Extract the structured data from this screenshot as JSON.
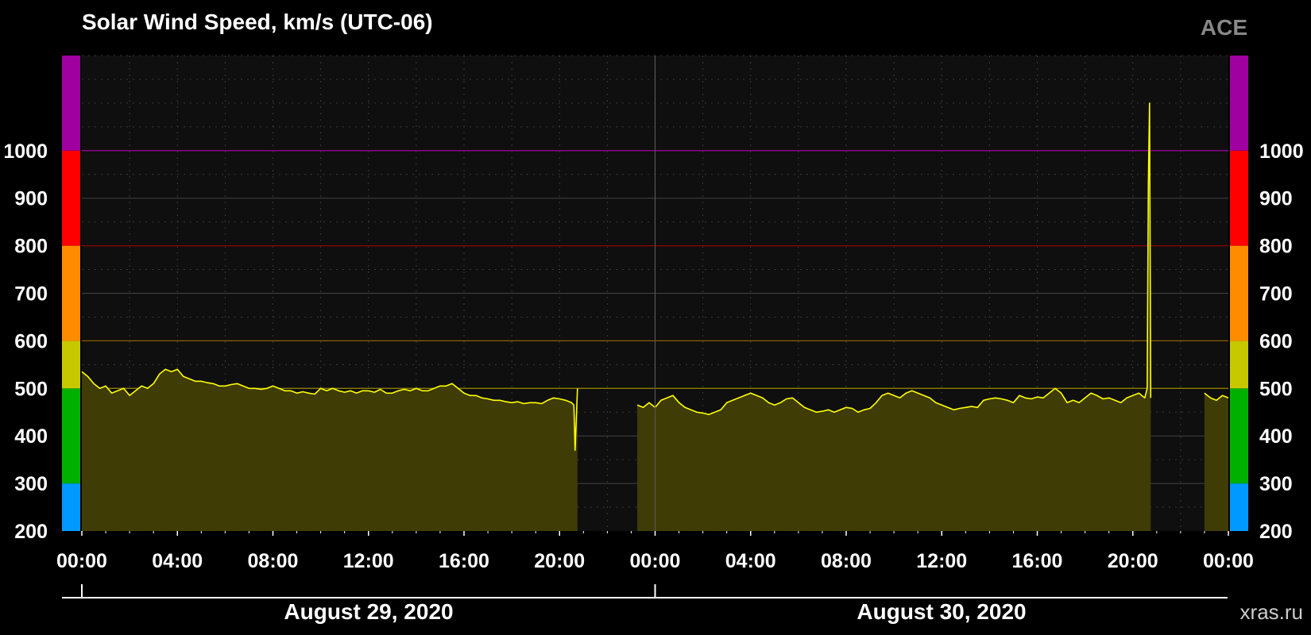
{
  "chart_data": {
    "type": "area",
    "title": "Solar Wind Speed, km/s (UTC-06)",
    "instrument": "ACE",
    "credit": "xras.ru",
    "ylim": [
      200,
      1200
    ],
    "yticks": [
      200,
      300,
      400,
      500,
      600,
      700,
      800,
      900,
      1000
    ],
    "ytick_labels": [
      "200",
      "300",
      "400",
      "500",
      "600",
      "700",
      "800",
      "900",
      "1000"
    ],
    "xlim": [
      0,
      48
    ],
    "xticks": [
      0,
      4,
      8,
      12,
      16,
      20,
      24,
      28,
      32,
      36,
      40,
      44,
      48
    ],
    "xtick_labels": [
      "00:00",
      "04:00",
      "08:00",
      "12:00",
      "16:00",
      "20:00",
      "00:00",
      "04:00",
      "08:00",
      "12:00",
      "16:00",
      "20:00",
      "00:00"
    ],
    "day_labels": [
      "August 29, 2020",
      "August 30, 2020"
    ],
    "grid": true,
    "threshold_bands": [
      {
        "from": 200,
        "to": 300,
        "color": "#0099ff"
      },
      {
        "from": 300,
        "to": 500,
        "color": "#00b000"
      },
      {
        "from": 500,
        "to": 600,
        "color": "#c8c800"
      },
      {
        "from": 600,
        "to": 800,
        "color": "#ff8c00"
      },
      {
        "from": 800,
        "to": 1000,
        "color": "#ff0000"
      },
      {
        "from": 1000,
        "to": 1200,
        "color": "#a000a0"
      }
    ],
    "threshold_lines": [
      {
        "value": 500,
        "color": "#8a7a00"
      },
      {
        "value": 600,
        "color": "#8a5a00"
      },
      {
        "value": 800,
        "color": "#8a0000"
      },
      {
        "value": 1000,
        "color": "#900090"
      }
    ],
    "line_color": "#ffff00",
    "fill_color": "#3f3c06",
    "series": [
      {
        "segments": [
          {
            "x": [
              0.0,
              0.25,
              0.5,
              0.75,
              1.0,
              1.25,
              1.5,
              1.75,
              2.0,
              2.25,
              2.5,
              2.75,
              3.0,
              3.25,
              3.5,
              3.75,
              4.0,
              4.25,
              4.5,
              4.75,
              5.0,
              5.25,
              5.5,
              5.75,
              6.0,
              6.25,
              6.5,
              6.75,
              7.0,
              7.25,
              7.5,
              7.75,
              8.0,
              8.25,
              8.5,
              8.75,
              9.0,
              9.25,
              9.5,
              9.75,
              10.0,
              10.25,
              10.5,
              10.75,
              11.0,
              11.25,
              11.5,
              11.75,
              12.0,
              12.25,
              12.5,
              12.75,
              13.0,
              13.25,
              13.5,
              13.75,
              14.0,
              14.25,
              14.5,
              14.75,
              15.0,
              15.25,
              15.5,
              15.75,
              16.0,
              16.25,
              16.5,
              16.75,
              17.0,
              17.25,
              17.5,
              17.75,
              18.0,
              18.25,
              18.5,
              18.75,
              19.0,
              19.25,
              19.5,
              19.75,
              20.0,
              20.25,
              20.5,
              20.6,
              20.65,
              20.75
            ],
            "y": [
              535,
              525,
              510,
              500,
              505,
              490,
              495,
              500,
              485,
              495,
              505,
              500,
              510,
              530,
              540,
              535,
              540,
              525,
              520,
              515,
              515,
              512,
              510,
              505,
              505,
              508,
              510,
              505,
              500,
              500,
              498,
              500,
              505,
              500,
              495,
              495,
              490,
              493,
              490,
              488,
              500,
              495,
              500,
              495,
              492,
              495,
              490,
              495,
              495,
              492,
              498,
              490,
              490,
              495,
              498,
              495,
              500,
              495,
              495,
              500,
              505,
              505,
              510,
              500,
              490,
              485,
              485,
              480,
              478,
              475,
              475,
              472,
              470,
              472,
              468,
              470,
              470,
              468,
              475,
              480,
              478,
              475,
              470,
              465,
              370,
              500
            ]
          },
          {
            "x": [
              23.25,
              23.5,
              23.75,
              24.0,
              24.25,
              24.5,
              24.75,
              25.0,
              25.25,
              25.5,
              25.75,
              26.0,
              26.25,
              26.5,
              26.75,
              27.0,
              27.25,
              27.5,
              27.75,
              28.0,
              28.25,
              28.5,
              28.75,
              29.0,
              29.25,
              29.5,
              29.75,
              30.0,
              30.25,
              30.5,
              30.75,
              31.0,
              31.25,
              31.5,
              31.75,
              32.0,
              32.25,
              32.5,
              32.75,
              33.0,
              33.25,
              33.5,
              33.75,
              34.0,
              34.25,
              34.5,
              34.75,
              35.0,
              35.25,
              35.5,
              35.75,
              36.0,
              36.25,
              36.5,
              36.75,
              37.0,
              37.25,
              37.5,
              37.75,
              38.0,
              38.25,
              38.5,
              38.75,
              39.0,
              39.25,
              39.5,
              39.75,
              40.0,
              40.25,
              40.5,
              40.75,
              41.0,
              41.25,
              41.5,
              41.75,
              42.0,
              42.25,
              42.5,
              42.75,
              43.0,
              43.25,
              43.5,
              43.75,
              44.0,
              44.25,
              44.5,
              44.6,
              44.65,
              44.7,
              44.75
            ],
            "y": [
              465,
              460,
              470,
              460,
              475,
              480,
              485,
              470,
              460,
              455,
              450,
              448,
              445,
              450,
              455,
              470,
              475,
              480,
              485,
              490,
              485,
              480,
              470,
              465,
              470,
              478,
              480,
              470,
              460,
              455,
              450,
              452,
              455,
              450,
              455,
              460,
              458,
              450,
              455,
              458,
              470,
              485,
              490,
              485,
              480,
              490,
              495,
              490,
              485,
              480,
              470,
              465,
              460,
              455,
              458,
              460,
              462,
              460,
              475,
              478,
              480,
              478,
              475,
              470,
              485,
              480,
              478,
              482,
              480,
              490,
              500,
              490,
              470,
              475,
              470,
              480,
              490,
              485,
              478,
              480,
              475,
              470,
              480,
              485,
              490,
              480,
              500,
              930,
              1100,
              480
            ]
          },
          {
            "x": [
              47.0,
              47.25,
              47.5,
              47.75,
              48.0
            ],
            "y": [
              490,
              480,
              475,
              485,
              480
            ]
          }
        ]
      }
    ]
  }
}
